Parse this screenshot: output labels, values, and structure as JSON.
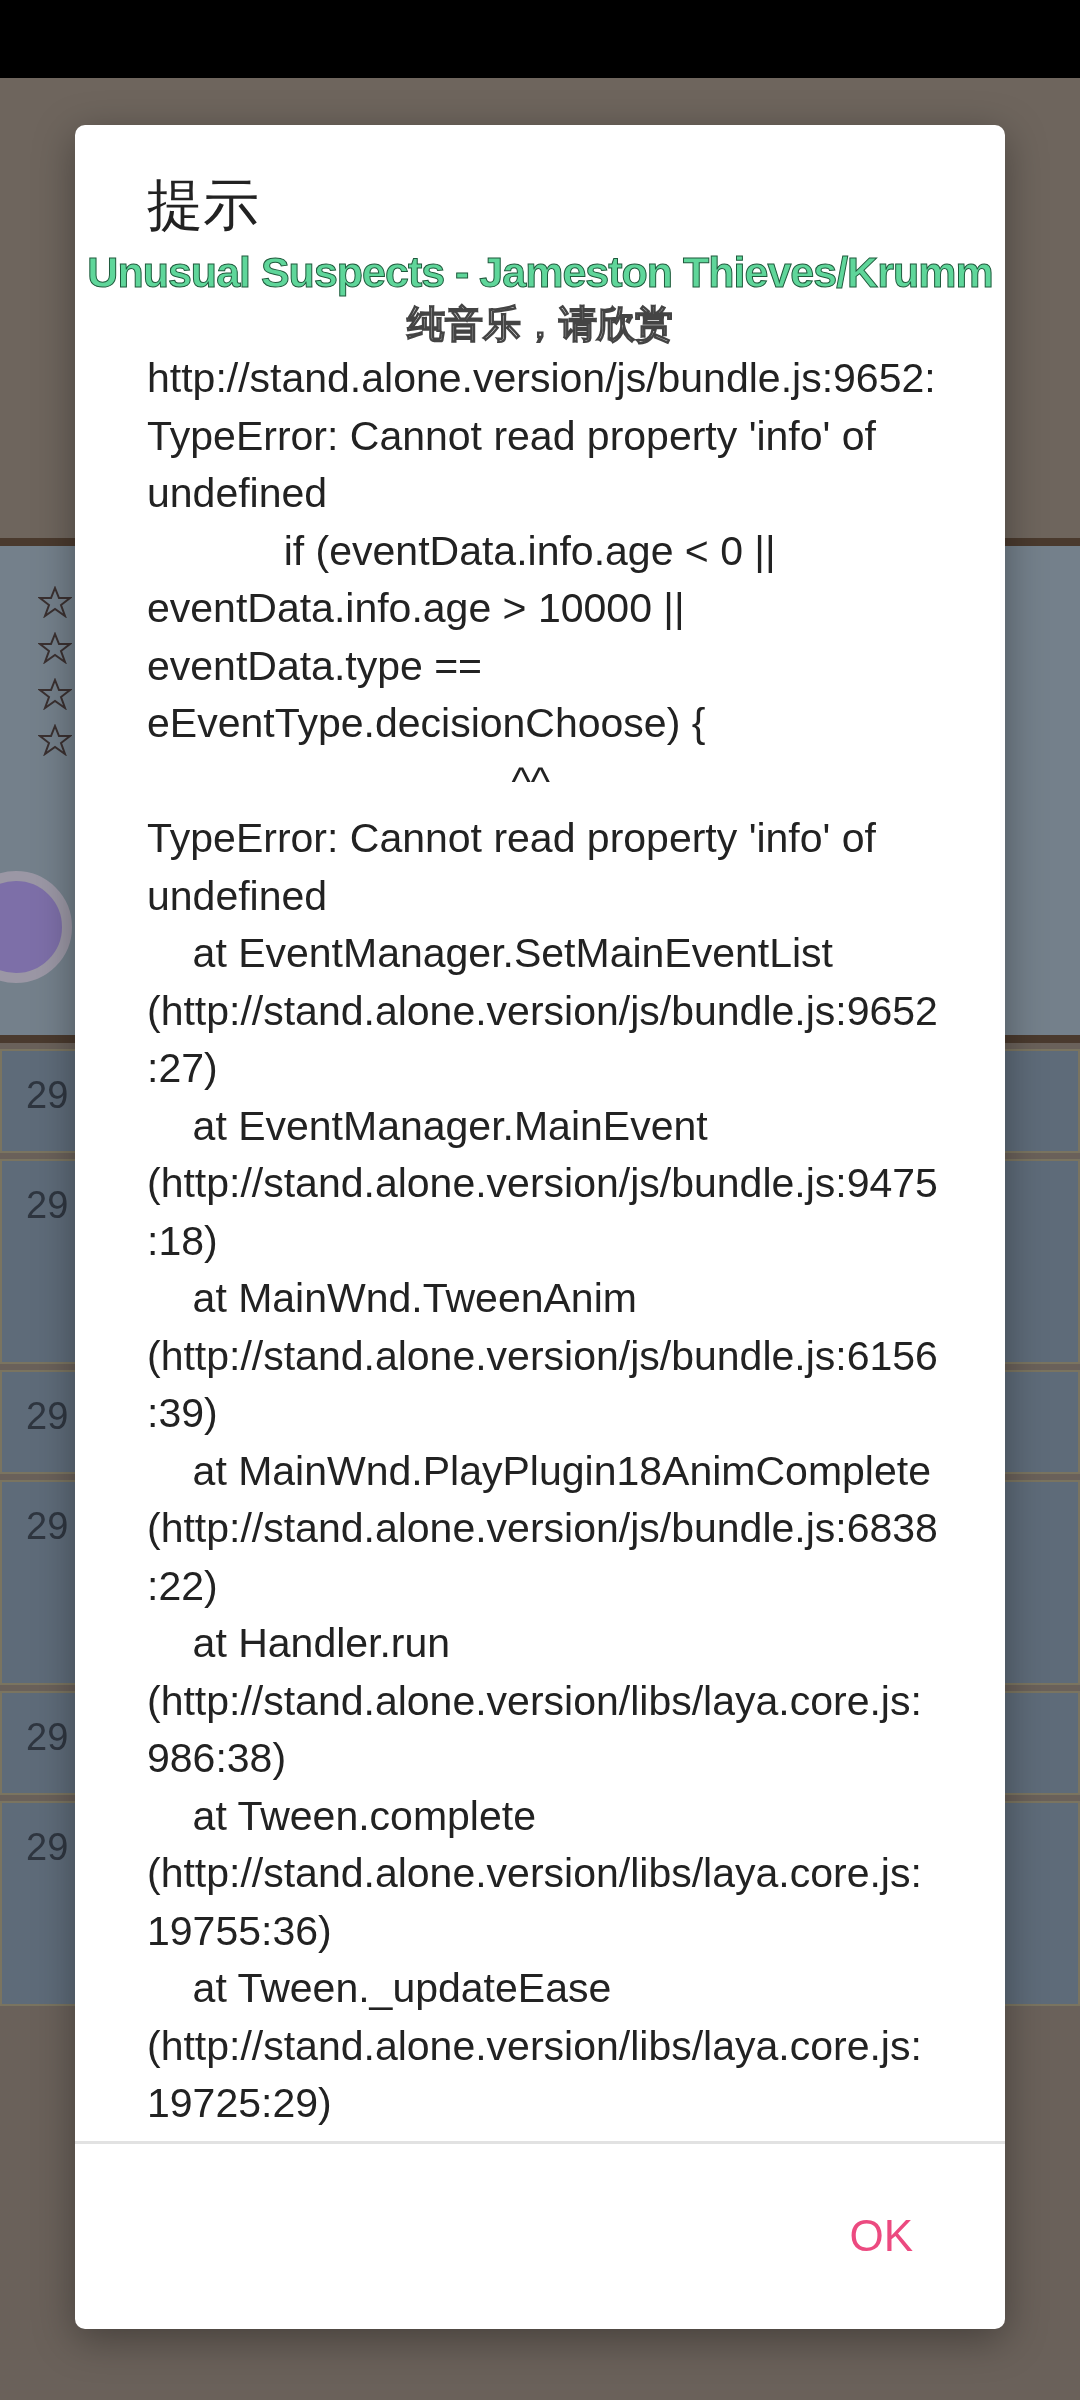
{
  "background": {
    "rows": [
      {
        "label": "29",
        "kind": "short"
      },
      {
        "label": "29",
        "kind": "tall"
      },
      {
        "label": "29",
        "kind": "short"
      },
      {
        "label": "29",
        "kind": "tall"
      },
      {
        "label": "29",
        "kind": "short"
      },
      {
        "label": "29",
        "kind": "tall"
      }
    ]
  },
  "dialog": {
    "title": "提示",
    "message_lines": [
      "http://stand.alone.version/js/bundle.js:9652:",
      "TypeError: Cannot read property 'info' of undefined",
      "            if (eventData.info.age < 0 || eventData.info.age > 10000 || eventData.type == eEventType.decisionChoose) {",
      "                                ^^",
      "TypeError: Cannot read property 'info' of undefined",
      "    at EventManager.SetMainEventList (http://stand.alone.version/js/bundle.js:9652:27)",
      "    at EventManager.MainEvent (http://stand.alone.version/js/bundle.js:9475:18)",
      "    at MainWnd.TweenAnim (http://stand.alone.version/js/bundle.js:6156:39)",
      "    at MainWnd.PlayPlugin18AnimComplete (http://stand.alone.version/js/bundle.js:6838:22)",
      "    at Handler.run (http://stand.alone.version/libs/laya.core.js:986:38)",
      "    at Tween.complete (http://stand.alone.version/libs/laya.core.js:19755:36)",
      "    at Tween._updateEase (http://stand.alone.version/libs/laya.core.js:19725:29)"
    ],
    "buttons": [
      "OK"
    ]
  },
  "lyrics_overlay": {
    "song": "Unusual Suspects - Jameston Thieves/Krumm",
    "line": "纯音乐，请欣赏"
  }
}
